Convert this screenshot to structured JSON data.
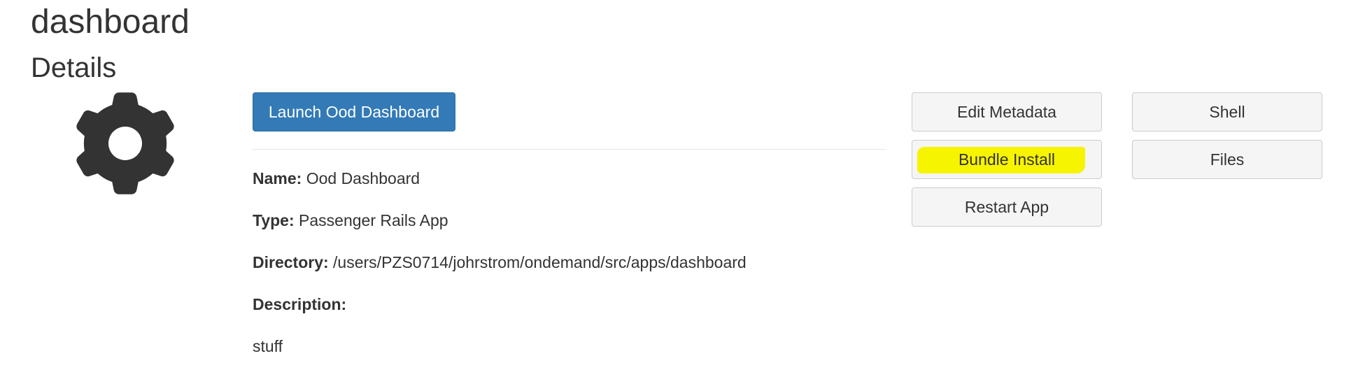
{
  "header": {
    "title": "dashboard",
    "section": "Details"
  },
  "app": {
    "icon": "gear-icon",
    "launch_label": "Launch Ood Dashboard",
    "name_label": "Name:",
    "name_value": "Ood Dashboard",
    "type_label": "Type:",
    "type_value": "Passenger Rails App",
    "directory_label": "Directory:",
    "directory_value": "/users/PZS0714/johrstrom/ondemand/src/apps/dashboard",
    "description_label": "Description:",
    "description_value": "stuff"
  },
  "actions": {
    "edit_metadata": "Edit Metadata",
    "bundle_install": "Bundle Install",
    "restart_app": "Restart App",
    "shell": "Shell",
    "files": "Files"
  },
  "colors": {
    "primary": "#337ab7",
    "highlight": "#f7f400",
    "icon": "#333333"
  }
}
